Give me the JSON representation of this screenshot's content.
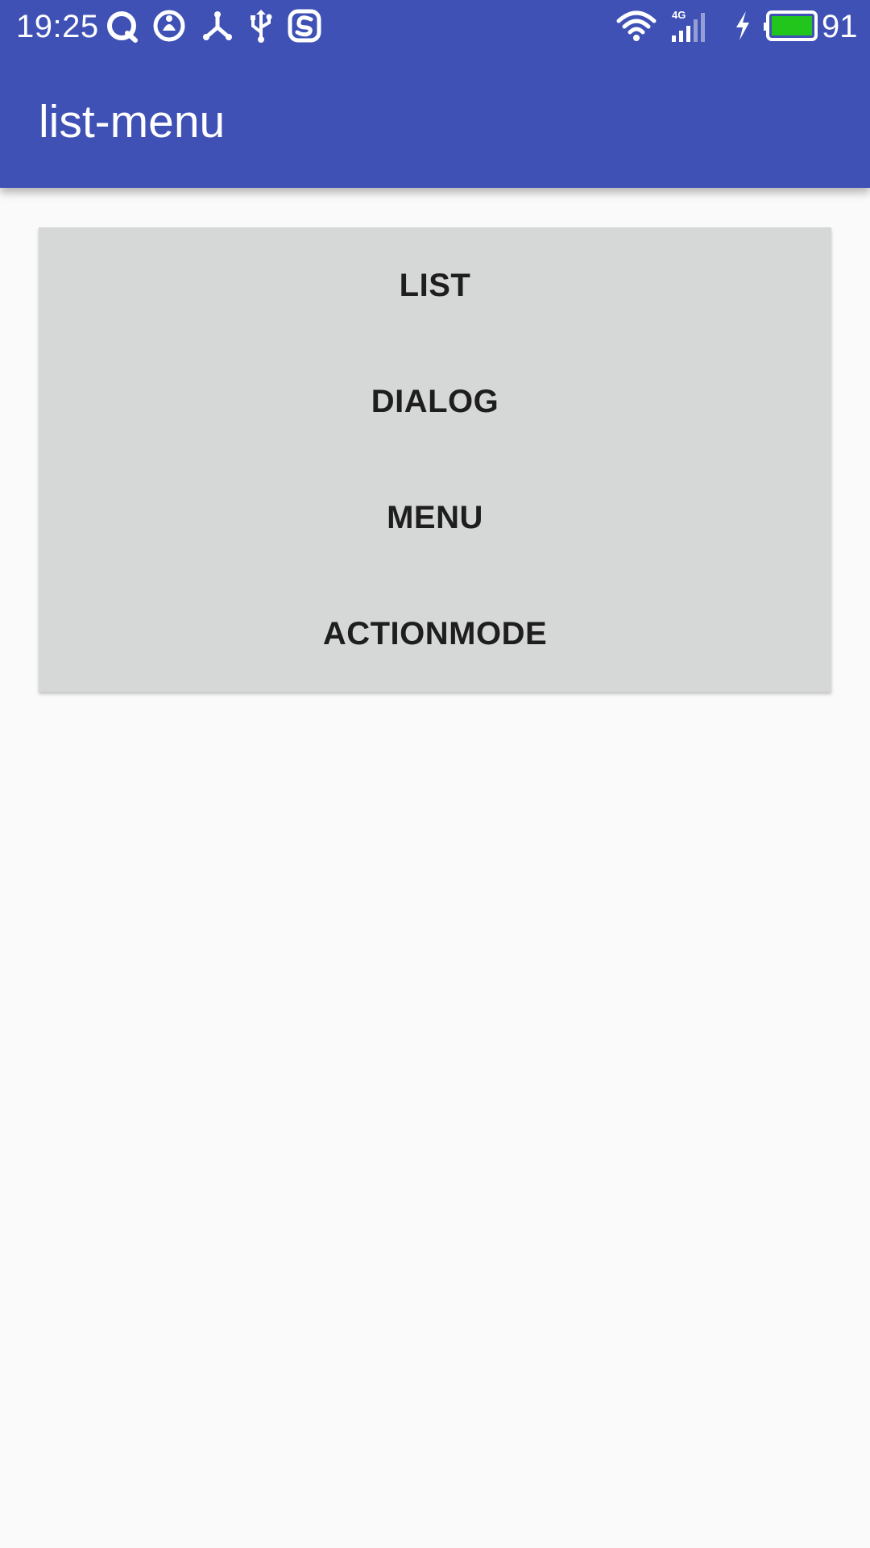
{
  "status_bar": {
    "time": "19:25",
    "battery_level": "91",
    "battery_color": "#22c51b",
    "icons": [
      "qq-icon",
      "music-icon",
      "share-icon",
      "usb-icon",
      "sogou-icon",
      "wifi-icon",
      "signal-4g-icon",
      "charging-icon",
      "battery-icon"
    ]
  },
  "app_bar": {
    "title": "list-menu",
    "color": "#3f51b5"
  },
  "buttons": [
    {
      "label": "LIST"
    },
    {
      "label": "DIALOG"
    },
    {
      "label": "MENU"
    },
    {
      "label": "ACTIONMODE"
    }
  ]
}
